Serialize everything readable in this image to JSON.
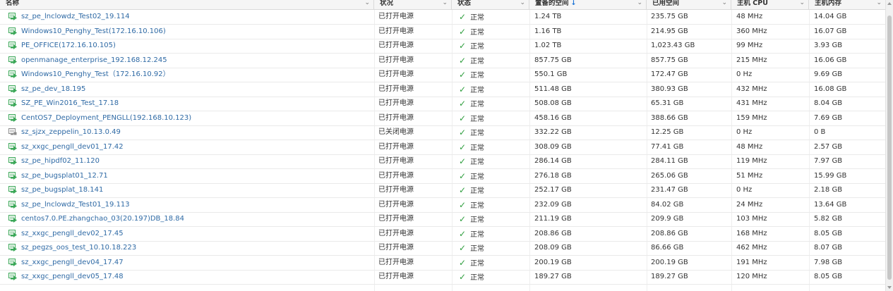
{
  "columns": {
    "name": "名称",
    "status": "状况",
    "state": "状态",
    "provisioned": "置备的空间",
    "used": "已用空间",
    "cpu": "主机 CPU",
    "memory": "主机内存"
  },
  "sort": {
    "column": "provisioned",
    "direction": "descending",
    "icon": "arrow-down-icon"
  },
  "colors": {
    "link": "#2f6aa5",
    "ok": "#2e9e3e",
    "vm_on": "#3aa757",
    "vm_off": "#8a8a8a"
  },
  "rows": [
    {
      "name": "sz_pe_lnclowdz_Test02_19.114",
      "power": "已打开电源",
      "state": "正常",
      "provisioned": "1.24 TB",
      "used": "235.75 GB",
      "cpu": "48 MHz",
      "memory": "14.04 GB",
      "on": true
    },
    {
      "name": "Windows10_Penghy_Test(172.16.10.106)",
      "power": "已打开电源",
      "state": "正常",
      "provisioned": "1.16 TB",
      "used": "214.95 GB",
      "cpu": "360 MHz",
      "memory": "16.07 GB",
      "on": true
    },
    {
      "name": "PE_OFFICE(172.16.10.105)",
      "power": "已打开电源",
      "state": "正常",
      "provisioned": "1.02 TB",
      "used": "1,023.43 GB",
      "cpu": "99 MHz",
      "memory": "3.93 GB",
      "on": true
    },
    {
      "name": "openmanage_enterprise_192.168.12.245",
      "power": "已打开电源",
      "state": "正常",
      "provisioned": "857.75 GB",
      "used": "857.75 GB",
      "cpu": "215 MHz",
      "memory": "16.06 GB",
      "on": true
    },
    {
      "name": "Windows10_Penghy_Test（172.16.10.92）",
      "power": "已打开电源",
      "state": "正常",
      "provisioned": "550.1 GB",
      "used": "172.47 GB",
      "cpu": "0 Hz",
      "memory": "9.69 GB",
      "on": true
    },
    {
      "name": "sz_pe_dev_18.195",
      "power": "已打开电源",
      "state": "正常",
      "provisioned": "511.48 GB",
      "used": "380.93 GB",
      "cpu": "432 MHz",
      "memory": "16.08 GB",
      "on": true
    },
    {
      "name": "SZ_PE_Win2016_Test_17.18",
      "power": "已打开电源",
      "state": "正常",
      "provisioned": "508.08 GB",
      "used": "65.31 GB",
      "cpu": "431 MHz",
      "memory": "8.04 GB",
      "on": true
    },
    {
      "name": "CentOS7_Deployment_PENGLL(192.168.10.123)",
      "power": "已打开电源",
      "state": "正常",
      "provisioned": "458.16 GB",
      "used": "388.66 GB",
      "cpu": "159 MHz",
      "memory": "7.69 GB",
      "on": true
    },
    {
      "name": "sz_sjzx_zeppelin_10.13.0.49",
      "power": "已关闭电源",
      "state": "正常",
      "provisioned": "332.22 GB",
      "used": "12.25 GB",
      "cpu": "0 Hz",
      "memory": "0 B",
      "on": false
    },
    {
      "name": "sz_xxgc_pengll_dev01_17.42",
      "power": "已打开电源",
      "state": "正常",
      "provisioned": "308.09 GB",
      "used": "77.41 GB",
      "cpu": "48 MHz",
      "memory": "2.57 GB",
      "on": true
    },
    {
      "name": "sz_pe_hipdf02_11.120",
      "power": "已打开电源",
      "state": "正常",
      "provisioned": "286.14 GB",
      "used": "284.11 GB",
      "cpu": "119 MHz",
      "memory": "7.97 GB",
      "on": true
    },
    {
      "name": "sz_pe_bugsplat01_12.71",
      "power": "已打开电源",
      "state": "正常",
      "provisioned": "276.18 GB",
      "used": "265.06 GB",
      "cpu": "51 MHz",
      "memory": "15.99 GB",
      "on": true
    },
    {
      "name": "sz_pe_bugsplat_18.141",
      "power": "已打开电源",
      "state": "正常",
      "provisioned": "252.17 GB",
      "used": "231.47 GB",
      "cpu": "0 Hz",
      "memory": "2.18 GB",
      "on": true
    },
    {
      "name": "sz_pe_lnclowdz_Test01_19.113",
      "power": "已打开电源",
      "state": "正常",
      "provisioned": "232.09 GB",
      "used": "84.02 GB",
      "cpu": "24 MHz",
      "memory": "13.64 GB",
      "on": true
    },
    {
      "name": "centos7.0.PE.zhangchao_03(20.197)DB_18.84",
      "power": "已打开电源",
      "state": "正常",
      "provisioned": "211.19 GB",
      "used": "209.9 GB",
      "cpu": "103 MHz",
      "memory": "5.82 GB",
      "on": true
    },
    {
      "name": "sz_xxgc_pengll_dev02_17.45",
      "power": "已打开电源",
      "state": "正常",
      "provisioned": "208.86 GB",
      "used": "208.86 GB",
      "cpu": "168 MHz",
      "memory": "8.05 GB",
      "on": true
    },
    {
      "name": "sz_pegzs_oos_test_10.10.18.223",
      "power": "已打开电源",
      "state": "正常",
      "provisioned": "208.09 GB",
      "used": "86.66 GB",
      "cpu": "462 MHz",
      "memory": "8.07 GB",
      "on": true
    },
    {
      "name": "sz_xxgc_pengll_dev04_17.47",
      "power": "已打开电源",
      "state": "正常",
      "provisioned": "200.19 GB",
      "used": "200.19 GB",
      "cpu": "191 MHz",
      "memory": "7.98 GB",
      "on": true
    },
    {
      "name": "sz_xxgc_pengll_dev05_17.48",
      "power": "已打开电源",
      "state": "正常",
      "provisioned": "189.27 GB",
      "used": "189.27 GB",
      "cpu": "120 MHz",
      "memory": "8.05 GB",
      "on": true
    }
  ]
}
